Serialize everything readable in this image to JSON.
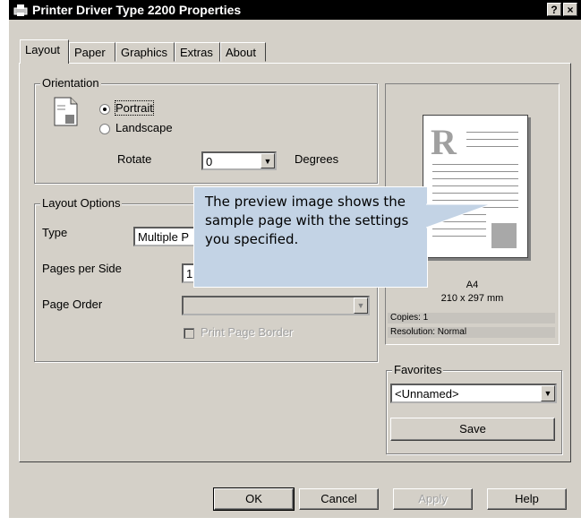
{
  "window": {
    "title": "Printer Driver Type 2200 Properties",
    "help_btn": "?",
    "close_btn": "×"
  },
  "tabs": [
    "Layout",
    "Paper",
    "Graphics",
    "Extras",
    "About"
  ],
  "orientation": {
    "legend": "Orientation",
    "portrait": "Portrait",
    "landscape": "Landscape",
    "selected": "Portrait",
    "rotate_label": "Rotate",
    "rotate_value": "0",
    "degrees_label": "Degrees"
  },
  "layout_options": {
    "legend": "Layout Options",
    "type_label": "Type",
    "type_value": "Multiple P",
    "pages_label": "Pages per Side",
    "pages_value": "1",
    "order_label": "Page Order",
    "order_value": "",
    "border_label": "Print Page Border"
  },
  "preview": {
    "letter": "R",
    "paper_name": "A4",
    "paper_size": "210 x 297 mm",
    "copies": "Copies: 1",
    "resolution": "Resolution: Normal"
  },
  "favorites": {
    "legend": "Favorites",
    "value": "<Unnamed>",
    "save": "Save"
  },
  "buttons": {
    "ok": "OK",
    "cancel": "Cancel",
    "apply": "Apply",
    "help": "Help"
  },
  "callout": {
    "text": "The preview image shows the sample page with the settings you specified."
  },
  "icons": {
    "app": "printer-icon",
    "document": "document-icon"
  }
}
